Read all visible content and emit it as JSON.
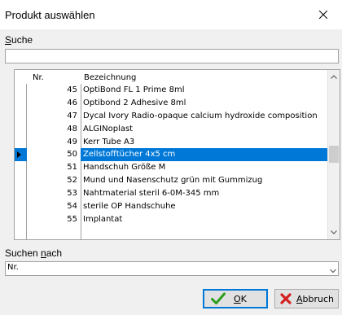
{
  "window": {
    "title": "Produkt auswählen"
  },
  "search": {
    "label_first": "S",
    "label_rest": "uche",
    "value": ""
  },
  "grid": {
    "columns": {
      "nr": "Nr.",
      "bezeichnung": "Bezeichnung"
    },
    "rows": [
      {
        "nr": "45",
        "bez": "OptiBond FL  1 Prime 8ml"
      },
      {
        "nr": "46",
        "bez": "Optibond 2 Adhesive 8ml"
      },
      {
        "nr": "47",
        "bez": "Dycal Ivory Radio-opaque calcium hydroxide composition"
      },
      {
        "nr": "48",
        "bez": "ALGINoplast"
      },
      {
        "nr": "49",
        "bez": "Kerr  Tube A3"
      },
      {
        "nr": "50",
        "bez": "Zellstofftücher 4x5 cm"
      },
      {
        "nr": "51",
        "bez": "Handschuh Größe M"
      },
      {
        "nr": "52",
        "bez": "Mund und Nasenschutz grün mit Gummizug"
      },
      {
        "nr": "53",
        "bez": "Nahtmaterial steril 6-0M-345 mm"
      },
      {
        "nr": "54",
        "bez": "sterile OP Handschuhe"
      },
      {
        "nr": "55",
        "bez": "Implantat"
      }
    ],
    "selected_nr": "50"
  },
  "search_by": {
    "label_first": "Suchen ",
    "label_u": "n",
    "label_rest": "ach",
    "value": "Nr."
  },
  "buttons": {
    "ok_u": "O",
    "ok_rest": "K",
    "cancel_u": "A",
    "cancel_rest": "bbruch"
  },
  "colors": {
    "selection": "#0078d7",
    "ok_icon": "#2e9e1f",
    "cancel_icon": "#d42020"
  },
  "icons": {
    "close": "close-icon",
    "ok": "checkmark-icon",
    "cancel": "x-icon",
    "row_pointer": "row-pointer-icon"
  }
}
